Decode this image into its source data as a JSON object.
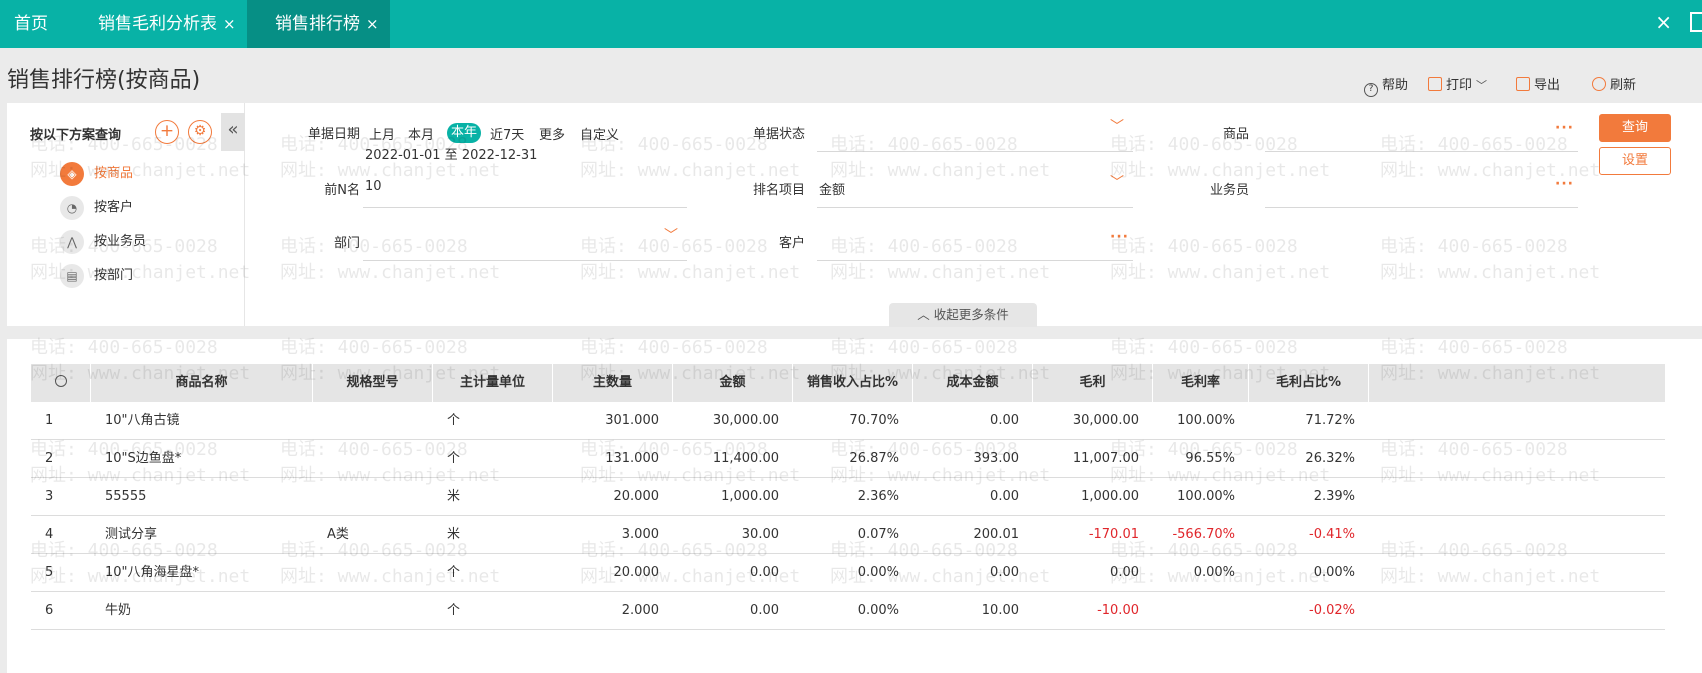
{
  "tabs": {
    "home": "首页",
    "tab1": "销售毛利分析表",
    "tab2": "销售排行榜",
    "close": "×"
  },
  "page": {
    "title": "销售排行榜(按商品)"
  },
  "toolbar": {
    "help": "帮助",
    "print": "打印",
    "export": "导出",
    "refresh": "刷新"
  },
  "scheme": {
    "title": "按以下方案查询",
    "items": [
      {
        "label": "按商品",
        "icon": "box-icon"
      },
      {
        "label": "按客户",
        "icon": "clock-icon"
      },
      {
        "label": "按业务员",
        "icon": "chart-icon"
      },
      {
        "label": "按部门",
        "icon": "dept-icon"
      }
    ]
  },
  "filters": {
    "date_label": "单据日期",
    "periods": [
      "上月",
      "本月",
      "本年",
      "近7天",
      "更多",
      "自定义"
    ],
    "active_period": "本年",
    "date_range": "2022-01-01 至 2022-12-31",
    "status_label": "单据状态",
    "status_value": "",
    "product_label": "商品",
    "topn_label": "前N名",
    "topn_value": "10",
    "rank_label": "排名项目",
    "rank_value": "金额",
    "salesman_label": "业务员",
    "dept_label": "部门",
    "customer_label": "客户",
    "query_btn": "查询",
    "settings_btn": "设置",
    "more_conditions": "收起更多条件"
  },
  "grid": {
    "headers": [
      "",
      "商品名称",
      "规格型号",
      "主计量单位",
      "主数量",
      "金额",
      "销售收入占比%",
      "成本金额",
      "毛利",
      "毛利率",
      "毛利占比%"
    ],
    "rows": [
      [
        "1",
        "10\"八角古镜",
        "",
        "个",
        "301.000",
        "30,000.00",
        "70.70%",
        "0.00",
        "30,000.00",
        "100.00%",
        "71.72%"
      ],
      [
        "2",
        "10\"S边鱼盘*",
        "",
        "个",
        "131.000",
        "11,400.00",
        "26.87%",
        "393.00",
        "11,007.00",
        "96.55%",
        "26.32%"
      ],
      [
        "3",
        "55555",
        "",
        "米",
        "20.000",
        "1,000.00",
        "2.36%",
        "0.00",
        "1,000.00",
        "100.00%",
        "2.39%"
      ],
      [
        "4",
        "测试分享",
        "A类",
        "米",
        "3.000",
        "30.00",
        "0.07%",
        "200.01",
        "-170.01",
        "-566.70%",
        "-0.41%"
      ],
      [
        "5",
        "10\"八角海星盘*",
        "",
        "个",
        "20.000",
        "0.00",
        "0.00%",
        "0.00",
        "0.00",
        "0.00%",
        "0.00%"
      ],
      [
        "6",
        "牛奶",
        "",
        "个",
        "2.000",
        "0.00",
        "0.00%",
        "10.00",
        "-10.00",
        "",
        "-0.02%"
      ]
    ]
  },
  "watermark": {
    "phone": "电话: 400-665-0028",
    "site": "网址: www.chanjet.net"
  },
  "colors": {
    "teal": "#08b2a6",
    "orange": "#f27a3c",
    "negative": "#e0262b"
  }
}
